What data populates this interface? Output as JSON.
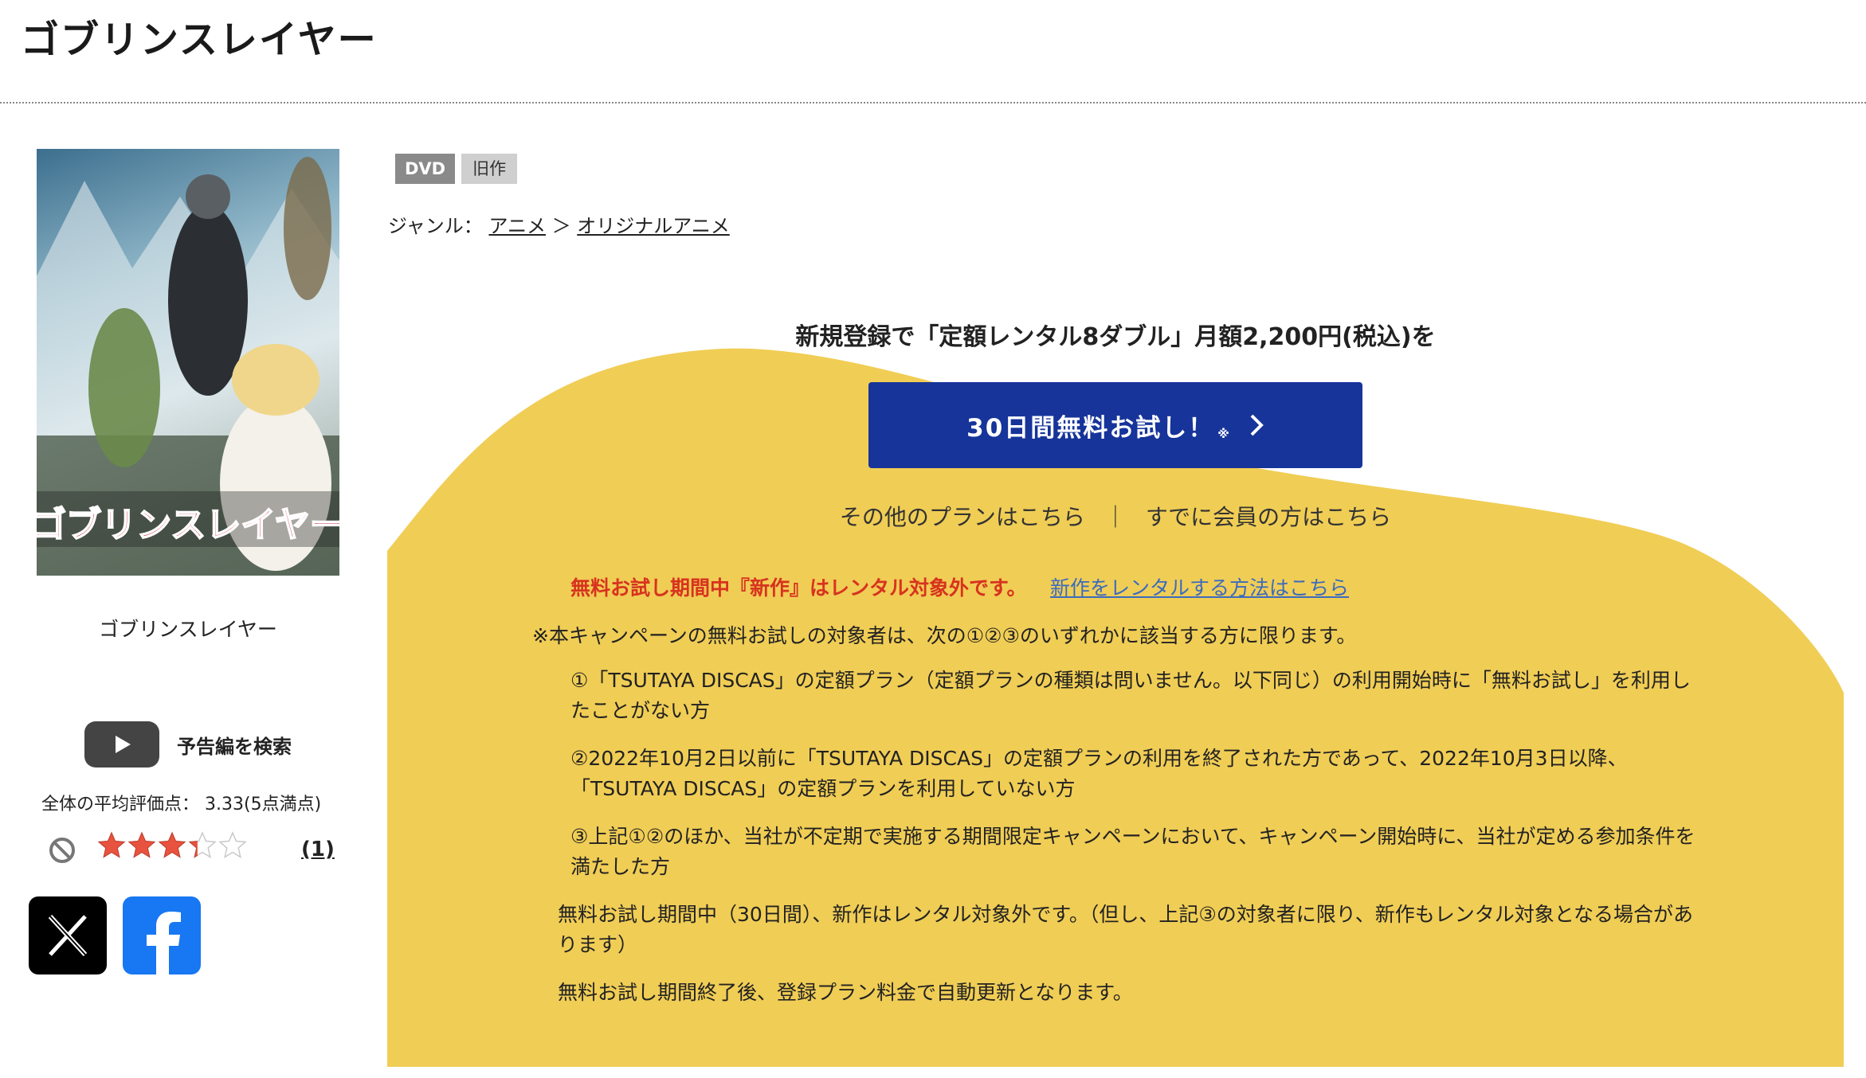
{
  "page": {
    "title": "ゴブリンスレイヤー"
  },
  "product": {
    "cover_logo": "ゴブリンスレイヤー",
    "caption": "ゴブリンスレイヤー",
    "badges": {
      "format": "DVD",
      "status": "旧作"
    },
    "genre": {
      "label": "ジャンル：",
      "level1": "アニメ",
      "separator": "＞",
      "level2": "オリジナルアニメ"
    }
  },
  "trailer": {
    "label": "予告編を検索",
    "icon": "youtube-play-icon"
  },
  "rating": {
    "average_label": "全体の平均評価点：",
    "average_value": "3.33(5点満点)",
    "stars_value": 3.33,
    "stars_max": 5,
    "review_count": "(1)"
  },
  "social": {
    "x_icon": "x-logo-icon",
    "facebook_icon": "facebook-logo-icon"
  },
  "promo": {
    "headline": "新規登録で「定額レンタル8ダブル」月額2,200円(税込)を",
    "cta_label": "30日間無料お試し！",
    "cta_note": "※",
    "other_plans": "その他のプランはこちら",
    "separator": "｜",
    "member_link": "すでに会員の方はこちら",
    "notice": "無料お試し期間中『新作』はレンタル対象外です。",
    "notice_link": "新作をレンタルする方法はこちら",
    "eligibility": "※本キャンペーンの無料お試しの対象者は、次の①②③のいずれかに該当する方に限ります。",
    "conditions": [
      "①「TSUTAYA DISCAS」の定額プラン（定額プランの種類は問いません。以下同じ）の利用開始時に「無料お試し」を利用したことがない方",
      "②2022年10月2日以前に「TSUTAYA DISCAS」の定額プランの利用を終了された方であって、2022年10月3日以降、「TSUTAYA DISCAS」の定額プランを利用していない方",
      "③上記①②のほか、当社が不定期で実施する期間限定キャンペーンにおいて、キャンペーン開始時に、当社が定める参加条件を満たした方"
    ],
    "footnotes": [
      "無料お試し期間中（30日間）、新作はレンタル対象外です。（但し、上記③の対象者に限り、新作もレンタル対象となる場合があります）",
      "無料お試し期間終了後、登録プラン料金で自動更新となります。"
    ],
    "colors": {
      "background": "#f0cd55",
      "button": "#16349a",
      "notice": "#d7331f",
      "link": "#3c6bbf"
    }
  }
}
